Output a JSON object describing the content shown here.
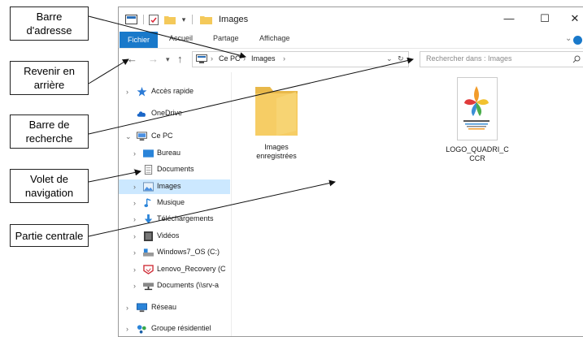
{
  "window": {
    "title": "Images",
    "controls": {
      "minimize": "—",
      "maximize": "☐",
      "close": "✕"
    }
  },
  "ribbon": {
    "tabs": [
      "Fichier",
      "Accueil",
      "Partage",
      "Affichage"
    ]
  },
  "address_bar": {
    "breadcrumbs": [
      "Ce PC",
      "Images"
    ]
  },
  "search": {
    "placeholder": "Rechercher dans : Images"
  },
  "nav_pane": {
    "items": [
      {
        "label": "Accès rapide",
        "icon": "star-icon"
      },
      {
        "label": "OneDrive",
        "icon": "cloud-icon"
      },
      {
        "label": "Ce PC",
        "icon": "computer-icon",
        "expanded": true
      },
      {
        "label": "Bureau",
        "icon": "desktop-folder-icon"
      },
      {
        "label": "Documents",
        "icon": "documents-icon"
      },
      {
        "label": "Images",
        "icon": "pictures-icon",
        "selected": true
      },
      {
        "label": "Musique",
        "icon": "music-icon"
      },
      {
        "label": "Téléchargements",
        "icon": "download-icon"
      },
      {
        "label": "Vidéos",
        "icon": "video-icon"
      },
      {
        "label": "Windows7_OS (C:)",
        "icon": "drive-icon"
      },
      {
        "label": "Lenovo_Recovery (C",
        "icon": "recovery-drive-icon"
      },
      {
        "label": "Documents (\\\\srv-a",
        "icon": "network-drive-icon"
      },
      {
        "label": "Réseau",
        "icon": "network-icon"
      },
      {
        "label": "Groupe résidentiel",
        "icon": "homegroup-icon"
      }
    ]
  },
  "content": {
    "items": [
      {
        "label_lines": [
          "Images",
          "enregistrées"
        ],
        "icon": "folder-icon"
      },
      {
        "label_lines": [
          "LOGO_QUADRI_C",
          "CCR"
        ],
        "icon": "image-thumbnail-icon"
      }
    ]
  },
  "annotations": [
    {
      "lines": [
        "Barre",
        "d'adresse"
      ]
    },
    {
      "lines": [
        "Revenir en",
        "arrière"
      ]
    },
    {
      "lines": [
        "Barre de",
        "recherche"
      ]
    },
    {
      "lines": [
        "Volet de",
        "navigation"
      ]
    },
    {
      "lines": [
        "Partie centrale"
      ]
    }
  ],
  "colors": {
    "accent": "#1979ca",
    "selection": "#cce8ff",
    "folder": "#f4c95a"
  }
}
